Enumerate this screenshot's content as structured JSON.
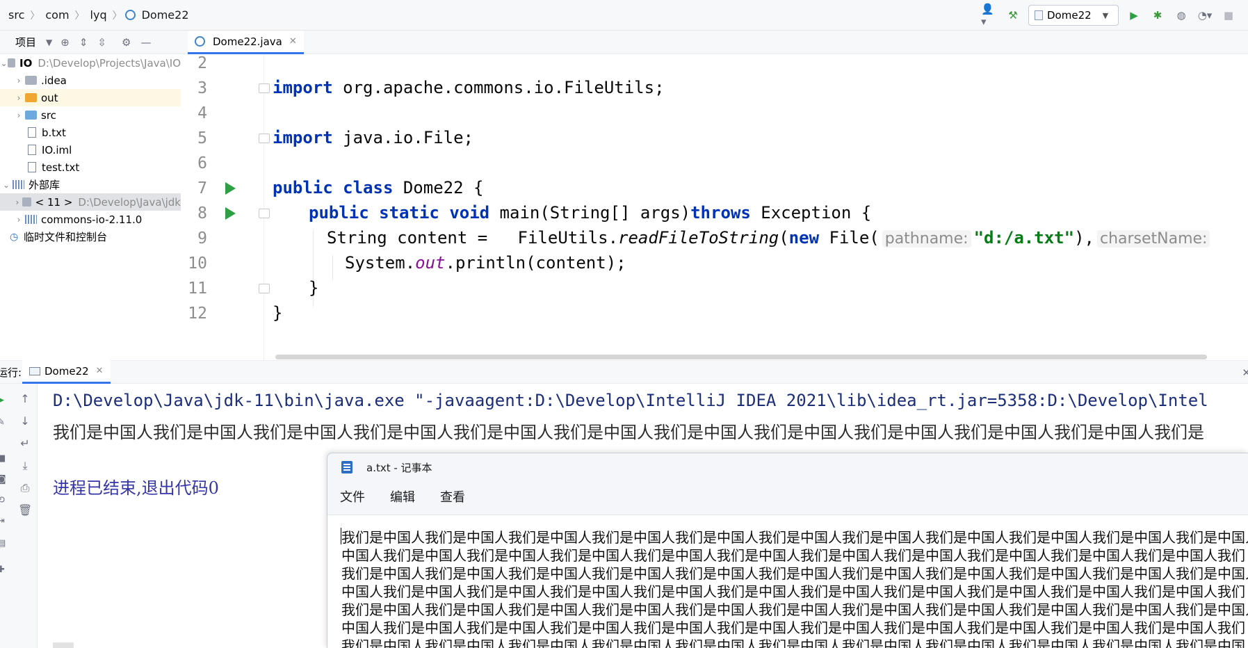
{
  "navbar": {
    "crumbs": [
      "src",
      "com",
      "lyq",
      "Dome22"
    ],
    "run_config": "Dome22"
  },
  "project_panel": {
    "title": "项目",
    "tree": [
      {
        "label": "IO",
        "path": "D:\\Develop\\Projects\\Java\\IO",
        "indent": 0,
        "arrow": "⌄",
        "icon": "folder-gray"
      },
      {
        "label": ".idea",
        "path": "",
        "indent": 1,
        "arrow": "›",
        "icon": "folder-gray"
      },
      {
        "label": "out",
        "path": "",
        "indent": 1,
        "arrow": "›",
        "icon": "folder-orange"
      },
      {
        "label": "src",
        "path": "",
        "indent": 1,
        "arrow": "›",
        "icon": "folder-blue"
      },
      {
        "label": "b.txt",
        "path": "",
        "indent": 1,
        "arrow": "",
        "icon": "file"
      },
      {
        "label": "IO.iml",
        "path": "",
        "indent": 1,
        "arrow": "",
        "icon": "file"
      },
      {
        "label": "test.txt",
        "path": "",
        "indent": 1,
        "arrow": "",
        "icon": "file"
      },
      {
        "label": "外部库",
        "path": "",
        "indent": 0,
        "arrow": "⌄",
        "icon": "library"
      },
      {
        "label": "< 11 >",
        "path": "D:\\Develop\\Java\\jdk",
        "indent": 1,
        "arrow": "›",
        "icon": "folder-gray"
      },
      {
        "label": "commons-io-2.11.0",
        "path": "",
        "indent": 1,
        "arrow": "›",
        "icon": "library"
      },
      {
        "label": "临时文件和控制台",
        "path": "",
        "indent": 0,
        "arrow": "",
        "icon": "scratch"
      }
    ]
  },
  "editor": {
    "tab_label": "Dome22.java",
    "line_numbers": [
      "2",
      "3",
      "4",
      "5",
      "6",
      "7",
      "8",
      "9",
      "10",
      "11",
      "12"
    ],
    "code": {
      "l3_kw": "import",
      "l3_rest": " org.apache.commons.io.FileUtils;",
      "l5_kw": "import",
      "l5_rest": " java.io.File;",
      "l7_kw1": "public",
      "l7_kw2": "class",
      "l7_rest": " Dome22 {",
      "l8_kw1": "public",
      "l8_kw2": "static",
      "l8_kw3": "void",
      "l8_mid": " main(String[] args)",
      "l8_kw4": "throws",
      "l8_rest": " Exception {",
      "l9_a": "String content =   FileUtils.",
      "l9_method": "readFileToString",
      "l9_b": "(",
      "l9_new": "new",
      "l9_c": " File(",
      "l9_hint1": "pathname:",
      "l9_str": "\"d:/a.txt\"",
      "l9_d": "),",
      "l9_hint2": "charsetName:",
      "l10_a": "System.",
      "l10_field": "out",
      "l10_b": ".println(content);",
      "l11": "}",
      "l12": "}"
    }
  },
  "run_panel": {
    "label": "运行:",
    "tab_label": "Dome22",
    "cmd": "D:\\Develop\\Java\\jdk-11\\bin\\java.exe \"-javaagent:D:\\Develop\\IntelliJ IDEA 2021\\lib\\idea_rt.jar=5358:D:\\Develop\\Intel",
    "output": "我们是中国人我们是中国人我们是中国人我们是中国人我们是中国人我们是中国人我们是中国人我们是中国人我们是中国人我们是中国人我们是中国人我们是",
    "exit": "进程已结束,退出代码0"
  },
  "notepad": {
    "title": "a.txt - 记事本",
    "menu": [
      "文件",
      "编辑",
      "查看"
    ],
    "lines": [
      "我们是中国人我们是中国人我们是中国人我们是中国人我们是中国人我们是中国人我们是中国人我们是中国人我们是中国人我们是中国人我们是中国人",
      "中国人我们是中国人我们是中国人我们是中国人我们是中国人我们是中国人我们是中国人我们是中国人我们是中国人我们是中国人我们是中国人我们",
      "我们是中国人我们是中国人我们是中国人我们是中国人我们是中国人我们是中国人我们是中国人我们是中国人我们是中国人我们是中国人我们是中国人",
      "中国人我们是中国人我们是中国人我们是中国人我们是中国人我们是中国人我们是中国人我们是中国人我们是中国人我们是中国人我们是中国人我们",
      "我们是中国人我们是中国人我们是中国人我们是中国人我们是中国人我们是中国人我们是中国人我们是中国人我们是中国人我们是中国人我们是中国人",
      "中国人我们是中国人我们是中国人我们是中国人我们是中国人我们是中国人我们是中国人我们是中国人我们是中国人我们是中国人我们是中国人我们",
      "我们是中国人我们是中国人我们是中国人我们是中国人我们是中国人我们是中国人我们是中国人我们是中国人我们是中国人我们是中国人我们是中国人"
    ]
  }
}
